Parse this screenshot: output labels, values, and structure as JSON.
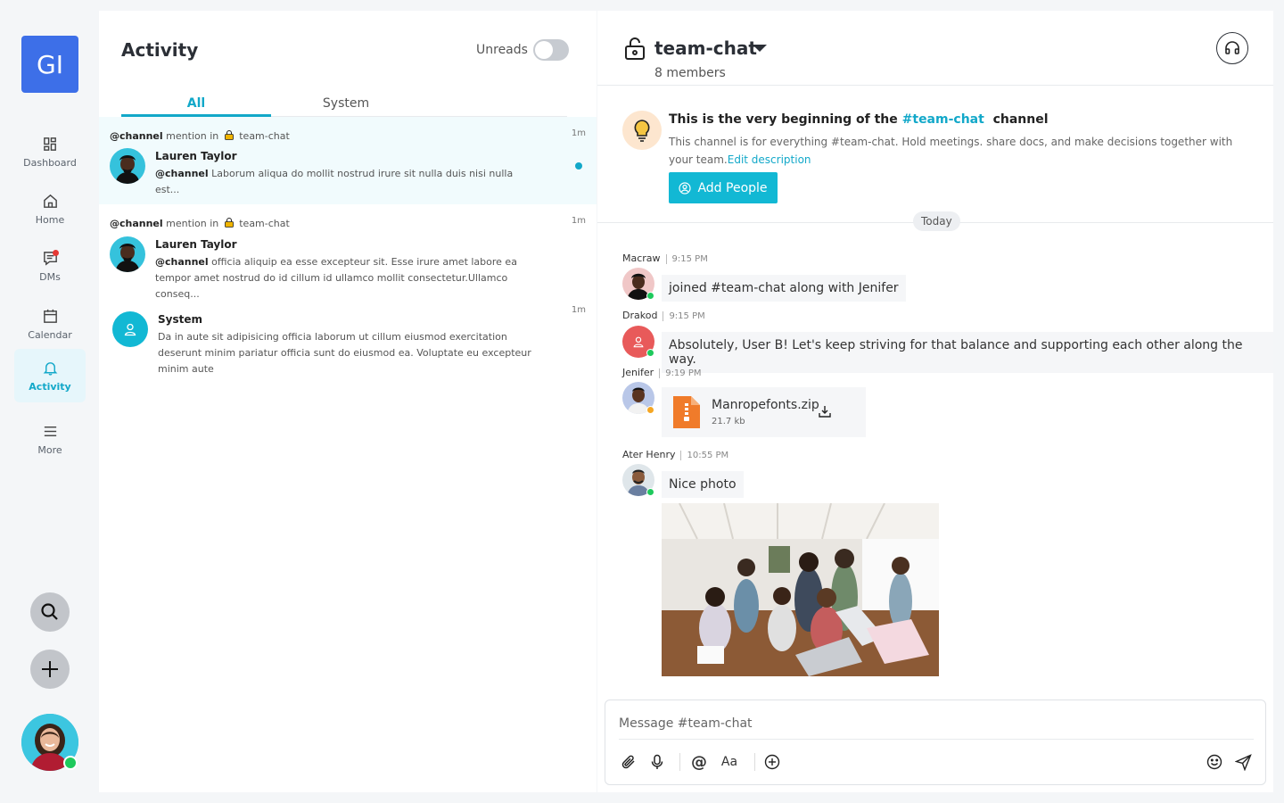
{
  "workspace": {
    "initials": "GI"
  },
  "nav": [
    {
      "label": "Dashboard"
    },
    {
      "label": "Home"
    },
    {
      "label": "DMs"
    },
    {
      "label": "Calendar"
    },
    {
      "label": "Activity"
    },
    {
      "label": "More"
    }
  ],
  "activity": {
    "title": "Activity",
    "unreads_label": "Unreads",
    "tabs": [
      {
        "label": "All"
      },
      {
        "label": "System"
      }
    ],
    "items": [
      {
        "mention": "@channel",
        "mention_rest": "mention in",
        "channel": "team-chat",
        "time": "1m",
        "name": "Lauren Taylor",
        "tag": "@channel",
        "text": "Laborum aliqua do mollit nostrud irure sit nulla duis nisi nulla est..."
      },
      {
        "mention": "@channel",
        "mention_rest": "mention in",
        "channel": "team-chat",
        "time": "1m",
        "name": "Lauren Taylor",
        "tag": "@channel",
        "text": "officia aliquip ea esse excepteur sit. Esse irure amet labore ea tempor amet nostrud do id cillum id ullamco mollit consectetur.Ullamco conseq..."
      },
      {
        "time": "1m",
        "name": "System",
        "text": "Da in aute sit adipisicing officia laborum ut cillum eiusmod exercitation deserunt minim pariatur officia sunt do eiusmod ea. Voluptate eu excepteur minim aute"
      }
    ]
  },
  "chat": {
    "channel": "team-chat",
    "members": "8 members",
    "intro": {
      "prefix": "This is the very beginning of the",
      "channel": "#team-chat",
      "suffix": "channel",
      "text": "This channel is for everything #team-chat. Hold meetings. share docs, and make decisions together with your team.",
      "link": "Edit description",
      "button": "Add People"
    },
    "day": "Today",
    "messages": [
      {
        "author": "Macraw",
        "time": "9:15 PM",
        "text": "joined #team-chat along with Jenifer"
      },
      {
        "author": "Drakod",
        "time": "9:15 PM",
        "text": "Absolutely, User B! Let's keep striving for that balance and supporting each other along the way."
      },
      {
        "author": "Jenifer",
        "time": "9:19 PM",
        "file_name": "Manropefonts.zip",
        "file_size": "21.7 kb"
      },
      {
        "author": "Ater Henry",
        "time": "10:55 PM",
        "text": "Nice photo"
      }
    ],
    "composer_placeholder": "Message #team-chat"
  },
  "colors": {
    "accent": "#12a8c9",
    "brand": "#3d6fe8",
    "online": "#1ec95c",
    "away": "#f5a623"
  }
}
